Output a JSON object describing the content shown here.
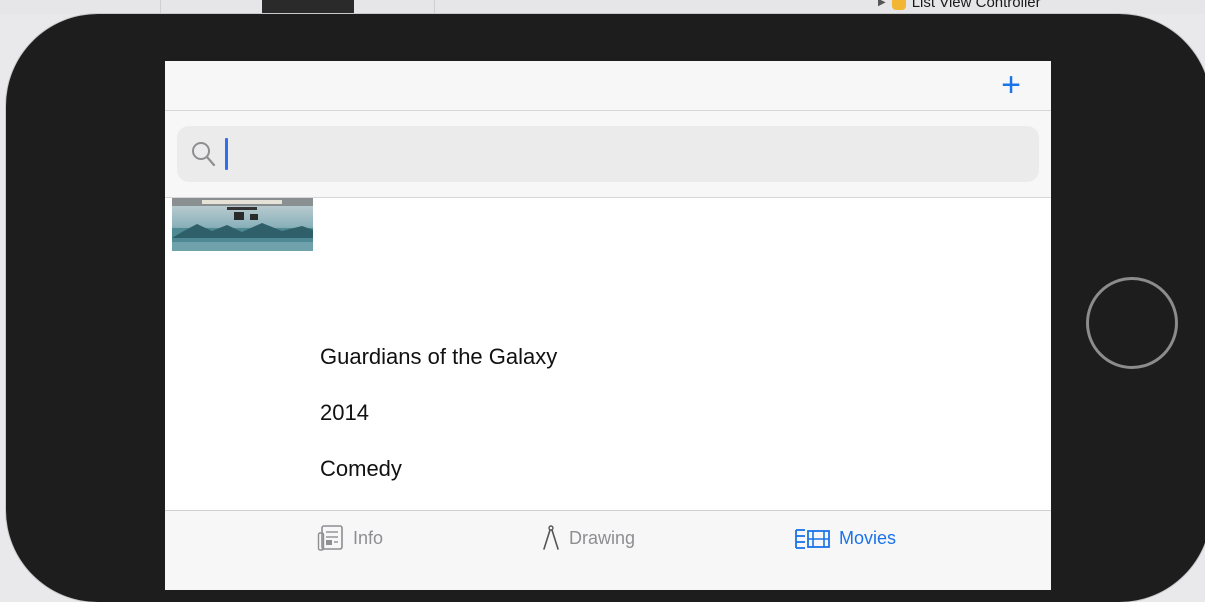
{
  "background": {
    "top_label": "List View Controller"
  },
  "navbar": {
    "add_label": "+"
  },
  "search": {
    "placeholder": "",
    "value": ""
  },
  "movie": {
    "title": "Guardians of the Galaxy",
    "year": "2014",
    "genre": "Comedy"
  },
  "tabbar": {
    "tabs": [
      {
        "label": "Info",
        "icon": "info-doc-icon",
        "active": false
      },
      {
        "label": "Drawing",
        "icon": "compass-icon",
        "active": false
      },
      {
        "label": "Movies",
        "icon": "movies-list-icon",
        "active": true
      }
    ]
  },
  "colors": {
    "accent": "#1a73e8",
    "inactive": "#8e8e93",
    "caret": "#2f6ff2",
    "bezel": "#1d1d1d"
  }
}
